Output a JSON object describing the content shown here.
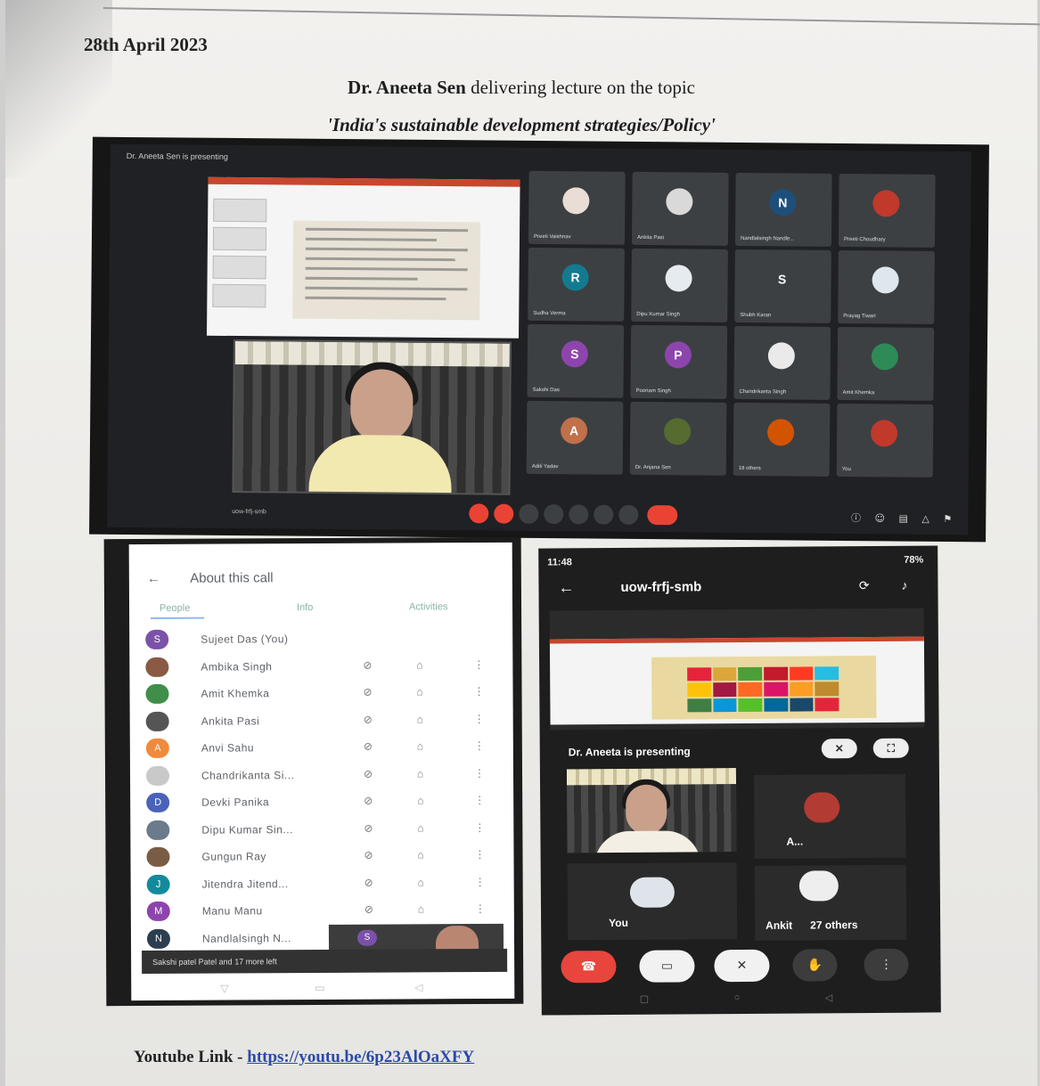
{
  "document": {
    "date": "28th April 2023",
    "heading_name": "Dr. Aneeta Sen",
    "heading_rest": "delivering lecture  on the topic",
    "topic": "'India's sustainable development strategies/Policy'",
    "youtube_label": "Youtube Link -",
    "youtube_url": "https://youtu.be/6p23AlOaXFY"
  },
  "desktop_meet": {
    "presenting_label": "Dr. Aneeta Sen is presenting",
    "meeting_code": "uow-frfj-smb",
    "tiles": [
      {
        "name": "Preeti Vaishnav",
        "initial": "",
        "color": "#e9ddd6"
      },
      {
        "name": "Ankita Pasi",
        "initial": "",
        "color": "#d9d9d9"
      },
      {
        "name": "Nandlalsingh Nandle...",
        "initial": "N",
        "color": "#1e4f7a"
      },
      {
        "name": "Preeti Choudhary",
        "initial": "",
        "color": "#c0392b"
      },
      {
        "name": "Sudha Verma",
        "initial": "R",
        "color": "#137a8f"
      },
      {
        "name": "Dipu Kumar Singh",
        "initial": "",
        "color": "#e6ebef"
      },
      {
        "name": "Shubh Karan",
        "initial": "S",
        "color": "#3c4043"
      },
      {
        "name": "Prayag Tiwari",
        "initial": "",
        "color": "#dfe7ee"
      },
      {
        "name": "Sakshi Das",
        "initial": "S",
        "color": "#8e44ad"
      },
      {
        "name": "Poonam Singh",
        "initial": "P",
        "color": "#8e44ad"
      },
      {
        "name": "Chandrikanta Singh",
        "initial": "",
        "color": "#eaeaea"
      },
      {
        "name": "Amit Khemka",
        "initial": "",
        "color": "#2e8b57"
      },
      {
        "name": "Aditi Yadav",
        "initial": "A",
        "color": "#c0704a"
      },
      {
        "name": "Dr. Anjana Sen",
        "initial": "",
        "color": "#556b2f"
      },
      {
        "name": "18 others",
        "initial": "",
        "color": "#d35400"
      },
      {
        "name": "You",
        "initial": "",
        "color": "#c0392b"
      }
    ]
  },
  "about_call": {
    "title": "About this call",
    "tabs": [
      "People",
      "Info",
      "Activities"
    ],
    "people": [
      {
        "name": "Sujeet Das (You)",
        "initial": "S",
        "color": "#7b52a8",
        "controls": false
      },
      {
        "name": "Ambika Singh",
        "initial": "",
        "color": "#8a5a44",
        "controls": true
      },
      {
        "name": "Amit Khemka",
        "initial": "",
        "color": "#3f8f4a",
        "controls": true
      },
      {
        "name": "Ankita Pasi",
        "initial": "",
        "color": "#555555",
        "controls": true
      },
      {
        "name": "Anvi Sahu",
        "initial": "A",
        "color": "#f08a3c",
        "controls": true
      },
      {
        "name": "Chandrikanta Si...",
        "initial": "",
        "color": "#c9c9c9",
        "controls": true
      },
      {
        "name": "Devki Panika",
        "initial": "D",
        "color": "#4a62b8",
        "controls": true
      },
      {
        "name": "Dipu Kumar Sin...",
        "initial": "",
        "color": "#6b7b8c",
        "controls": true
      },
      {
        "name": "Gungun Ray",
        "initial": "",
        "color": "#7a5c44",
        "controls": true
      },
      {
        "name": "Jitendra Jitend...",
        "initial": "J",
        "color": "#138a9c",
        "controls": true
      },
      {
        "name": "Manu Manu",
        "initial": "M",
        "color": "#8e44ad",
        "controls": true
      },
      {
        "name": "Nandlalsingh N...",
        "initial": "N",
        "color": "#2c3e50",
        "controls": false
      }
    ],
    "preview_initial": "S",
    "toast": "Sakshi patel Patel and 17 more left"
  },
  "mobile_meet": {
    "time": "11:48",
    "battery": "78%",
    "meeting_code": "uow-frfj-smb",
    "presenting": "Dr. Aneeta is presenting",
    "tile_a": "A...",
    "you": "You",
    "ankita": "Ankit",
    "others": "27 others",
    "sdg_colors": [
      "#e5243b",
      "#dda63a",
      "#4c9f38",
      "#c5192d",
      "#ff3a21",
      "#26bde2",
      "#fcc30b",
      "#a21942",
      "#fd6925",
      "#dd1367",
      "#fd9d24",
      "#bf8b2e",
      "#3f7e44",
      "#0a97d9",
      "#56c02b",
      "#00689d",
      "#19486a",
      "#e5243b"
    ]
  }
}
